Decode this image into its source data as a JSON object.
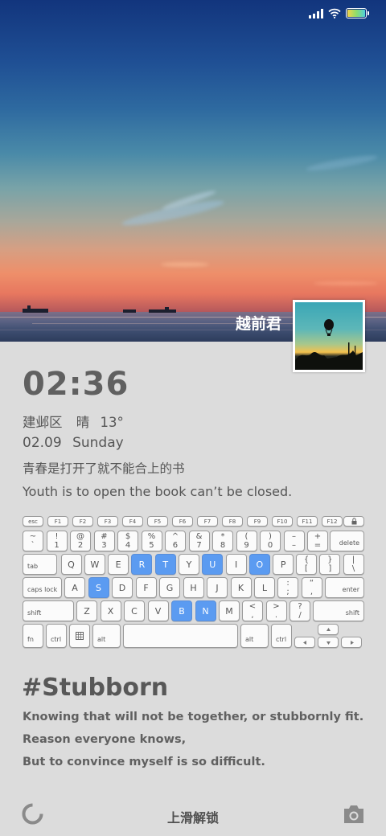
{
  "status_bar": {
    "icons": [
      "signal-icon",
      "wifi-icon",
      "battery-icon"
    ]
  },
  "wallpaper": {
    "author": "越前君"
  },
  "clock": {
    "time": "02:36"
  },
  "weather": {
    "location": "建邺区",
    "condition": "晴",
    "temperature": "13°"
  },
  "date": {
    "day": "02.09",
    "weekday": "Sunday"
  },
  "quote_cn": "青春是打开了就不能合上的书",
  "quote_en": "Youth is to open the book can’t be closed.",
  "keyboard": {
    "fn_row": [
      "esc",
      "F1",
      "F2",
      "F3",
      "F4",
      "F5",
      "F6",
      "F7",
      "F8",
      "F9",
      "F10",
      "F11",
      "F12"
    ],
    "num_row": [
      [
        "~",
        "`"
      ],
      [
        "!",
        "1"
      ],
      [
        "@",
        "2"
      ],
      [
        "#",
        "3"
      ],
      [
        "$",
        "4"
      ],
      [
        "%",
        "5"
      ],
      [
        "^",
        "6"
      ],
      [
        "&",
        "7"
      ],
      [
        "*",
        "8"
      ],
      [
        "(",
        "9"
      ],
      [
        ")",
        "0"
      ],
      [
        "–",
        "–"
      ],
      [
        "+",
        "="
      ]
    ],
    "delete": "delete",
    "tab": "tab",
    "q_row": [
      "Q",
      "W",
      "E",
      "R",
      "T",
      "Y",
      "U",
      "I",
      "O",
      "P"
    ],
    "q_row_symbols": [
      [
        "{",
        "["
      ],
      [
        "}",
        "]"
      ],
      [
        "|",
        "\\"
      ]
    ],
    "caps": "caps lock",
    "a_row": [
      "A",
      "S",
      "D",
      "F",
      "G",
      "H",
      "J",
      "K",
      "L"
    ],
    "a_row_symbols": [
      [
        ":",
        ";"
      ],
      [
        "“",
        ","
      ]
    ],
    "enter": "enter",
    "shift": "shift",
    "z_row": [
      "Z",
      "X",
      "C",
      "V",
      "B",
      "N",
      "M"
    ],
    "z_row_symbols": [
      [
        "<",
        ","
      ],
      [
        ">",
        "."
      ],
      [
        "?",
        "/"
      ]
    ],
    "fn": "fn",
    "ctrl": "ctrl",
    "alt": "alt",
    "highlighted": [
      "R",
      "T",
      "U",
      "O",
      "S",
      "B",
      "N"
    ]
  },
  "hashtag": "#Stubborn",
  "quote_lines": [
    "Knowing that will not be together, or stubbornly fit.",
    "Reason everyone knows,",
    "But to convince myself is so difficult."
  ],
  "unlock_label": "上滑解锁",
  "colors": {
    "highlight_key": "#5b9bf1",
    "panel_bg": "#dcdcdc",
    "text": "#555555"
  }
}
